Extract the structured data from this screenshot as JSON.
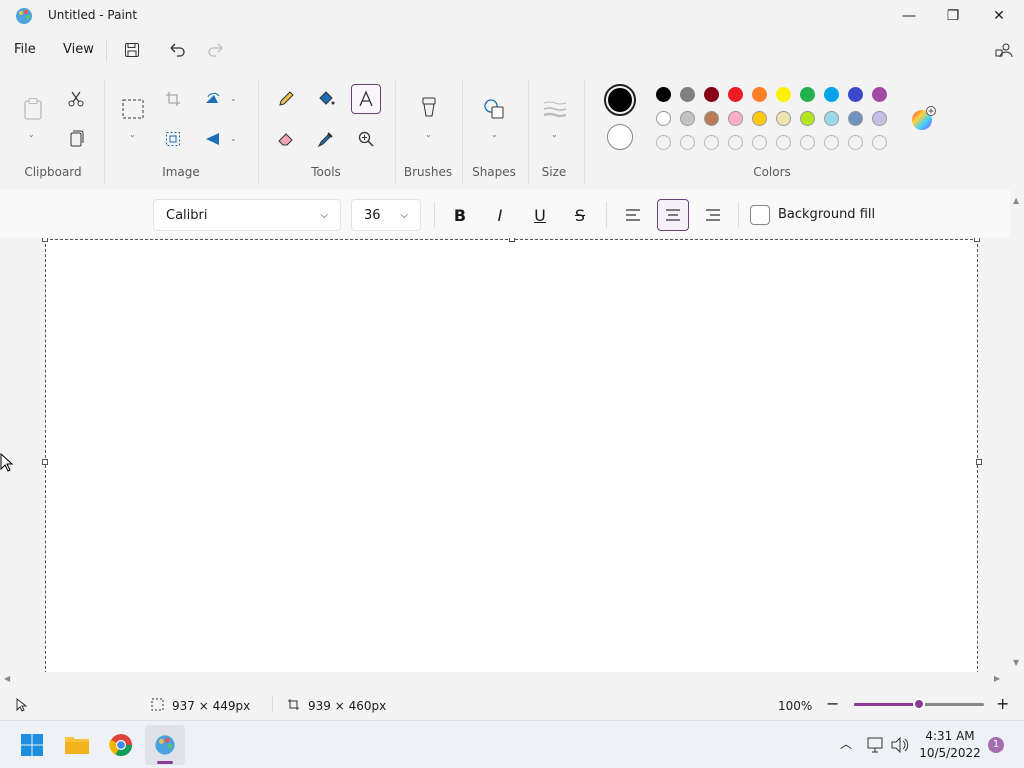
{
  "window": {
    "title": "Untitled - Paint",
    "minimize": "—",
    "maximize": "❐",
    "close": "✕"
  },
  "menu": {
    "file": "File",
    "view": "View"
  },
  "ribbon": {
    "groups": {
      "clipboard": "Clipboard",
      "image": "Image",
      "tools": "Tools",
      "brushes": "Brushes",
      "shapes": "Shapes",
      "size": "Size",
      "colors": "Colors"
    }
  },
  "palette": {
    "row1": [
      "#000000",
      "#7f7f7f",
      "#880015",
      "#ed1c24",
      "#ff7f27",
      "#fff200",
      "#22b14c",
      "#00a2e8",
      "#3f48cc",
      "#a349a4"
    ],
    "row2": [
      "#ffffff",
      "#c3c3c3",
      "#b97a57",
      "#ffaec9",
      "#ffc90e",
      "#efe4b0",
      "#b5e61d",
      "#99d9ea",
      "#7092be",
      "#c8bfe7"
    ],
    "primary": "#000000",
    "secondary": "#ffffff"
  },
  "text_toolbar": {
    "font": "Calibri",
    "size": "36",
    "bold": "B",
    "italic": "I",
    "underline": "U",
    "strike": "S",
    "background_fill": "Background fill"
  },
  "status": {
    "selection_size": "937 × 449px",
    "canvas_size": "939 × 460px",
    "zoom": "100%",
    "zoom_level": 0.5
  },
  "taskbar": {
    "time": "4:31 AM",
    "date": "10/5/2022",
    "notification_count": "1"
  },
  "accent": "#8b3a96"
}
